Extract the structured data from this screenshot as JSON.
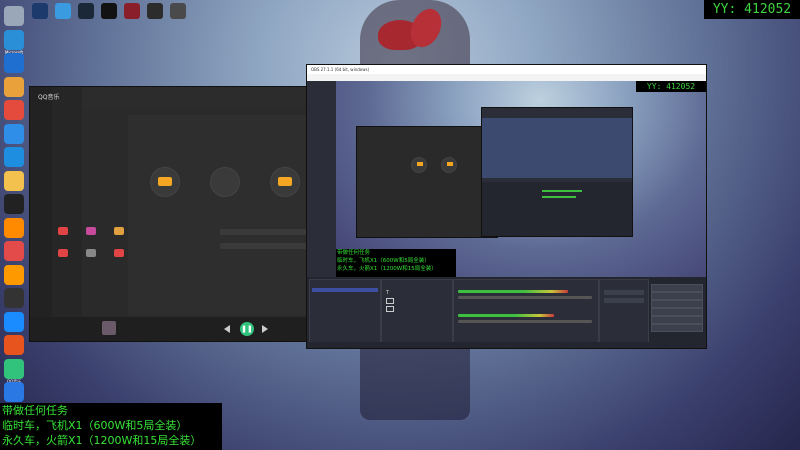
{
  "desktop": {
    "left_icons": [
      {
        "name": "pc-icon",
        "label": "",
        "color": "#9aa7b8"
      },
      {
        "name": "edge-icon",
        "label": "Microsoft Edge",
        "color": "#2a8fd6"
      },
      {
        "name": "security-icon",
        "label": "",
        "color": "#1f6fd1"
      },
      {
        "name": "photos-icon",
        "label": "",
        "color": "#e9a23b"
      },
      {
        "name": "chrome-icon",
        "label": "",
        "color": "#e54b3c"
      },
      {
        "name": "onedrive-icon",
        "label": "",
        "color": "#2f8ee8"
      },
      {
        "name": "ie-icon",
        "label": "",
        "color": "#1e8fe0"
      },
      {
        "name": "folder-icon",
        "label": "",
        "color": "#f2c14e"
      },
      {
        "name": "qq-icon",
        "label": "",
        "color": "#222222"
      },
      {
        "name": "app-icon",
        "label": "",
        "color": "#ff8a00"
      },
      {
        "name": "game-icon",
        "label": "",
        "color": "#e34b4b"
      },
      {
        "name": "video-icon",
        "label": "",
        "color": "#ff9900"
      },
      {
        "name": "obs-icon",
        "label": "",
        "color": "#333333"
      },
      {
        "name": "chat-icon",
        "label": "",
        "color": "#1a8cff"
      },
      {
        "name": "office-icon",
        "label": "",
        "color": "#e8541d"
      },
      {
        "name": "music-icon",
        "label": "QQ音乐",
        "color": "#31c27c"
      },
      {
        "name": "search-app-icon",
        "label": "",
        "color": "#2a78e4"
      }
    ],
    "top_icons": [
      {
        "name": "top-app-1-icon",
        "color": "#1c3a6b"
      },
      {
        "name": "top-app-2-icon",
        "color": "#3a9be0"
      },
      {
        "name": "steam-icon",
        "color": "#1b2838"
      },
      {
        "name": "top-app-4-icon",
        "color": "#121212"
      },
      {
        "name": "top-app-5-icon",
        "color": "#8a1e2a"
      },
      {
        "name": "top-app-6-icon",
        "color": "#2c2c2c"
      },
      {
        "name": "top-app-7-icon",
        "color": "#4a4a4a"
      }
    ]
  },
  "yy_badge": "YY: 412052",
  "overlay": {
    "line1": "带做任何任务",
    "line2": "临时车，飞机X1（600W和5局全装）",
    "line3": "永久车，火箭X1（1200W和15局全装）"
  },
  "qq_music": {
    "app_name": "QQ音乐",
    "playbar_glyph": "❚❚"
  },
  "obs": {
    "title": "OBS 27.1.1 (64 bit, windows)",
    "preview_yy": "YY: 412052",
    "preview_overlay": {
      "line1": "带做任何任务",
      "line2": "临时车，飞机X1（600W和5局全装）",
      "line3": "永久车，火箭X1（1200W和15局全装）"
    }
  },
  "colors": {
    "overlay_text": "#36e236",
    "accent_green": "#31c27c",
    "accent_orange": "#f5a623"
  }
}
